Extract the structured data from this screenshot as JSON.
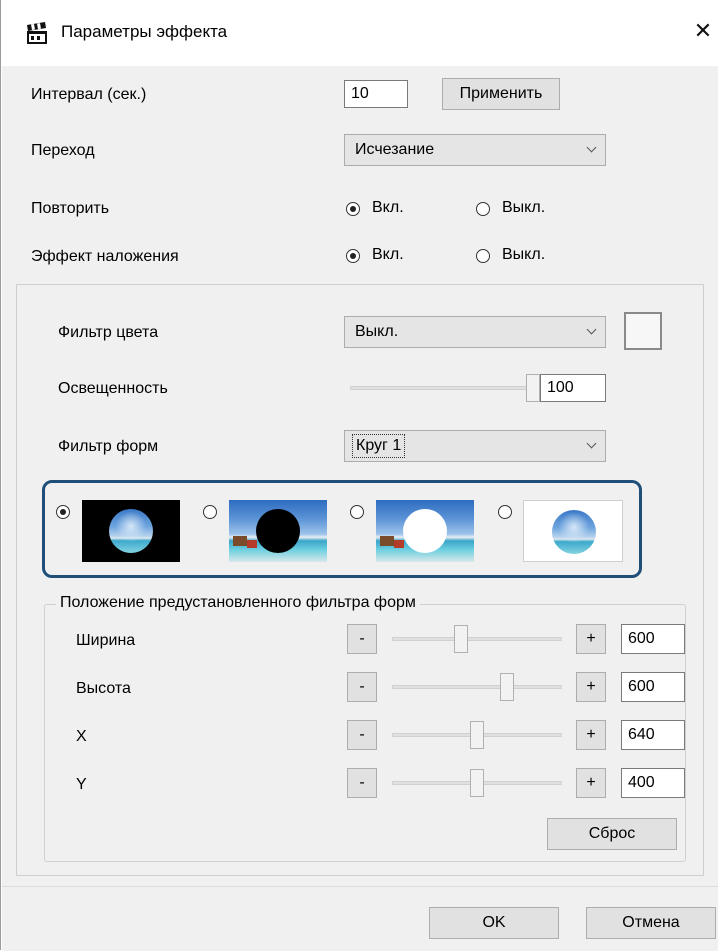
{
  "window": {
    "title": "Параметры эффекта",
    "close_symbol": "✕"
  },
  "interval": {
    "label": "Интервал (сек.)",
    "value": "10",
    "apply_label": "Применить"
  },
  "transition": {
    "label": "Переход",
    "value": "Исчезание"
  },
  "repeat": {
    "label": "Повторить",
    "on_label": "Вкл.",
    "off_label": "Выкл.",
    "selected": "on"
  },
  "overlay": {
    "label": "Эффект наложения",
    "on_label": "Вкл.",
    "off_label": "Выкл.",
    "selected": "on"
  },
  "color_filter": {
    "label": "Фильтр цвета",
    "value": "Выкл."
  },
  "brightness": {
    "label": "Освещенность",
    "value": "100",
    "level_percent": 100
  },
  "shape_filter": {
    "label": "Фильтр форм",
    "value": "Круг 1",
    "options": [
      {
        "id": "black-bg-image-circle",
        "selected": true
      },
      {
        "id": "image-bg-black-circle",
        "selected": false
      },
      {
        "id": "image-bg-white-circle",
        "selected": false
      },
      {
        "id": "white-bg-image-circle",
        "selected": false
      }
    ],
    "highlight_color": "#1f4e79"
  },
  "preset_position": {
    "title": "Положение предустановленного фильтра форм",
    "minus_label": "-",
    "plus_label": "+",
    "reset_label": "Сброс",
    "rows": [
      {
        "label": "Ширина",
        "value": "600",
        "slider_percent": 40
      },
      {
        "label": "Высота",
        "value": "600",
        "slider_percent": 69
      },
      {
        "label": "X",
        "value": "640",
        "slider_percent": 50
      },
      {
        "label": "Y",
        "value": "400",
        "slider_percent": 50
      }
    ]
  },
  "footer": {
    "ok_label": "OK",
    "cancel_label": "Отмена"
  }
}
